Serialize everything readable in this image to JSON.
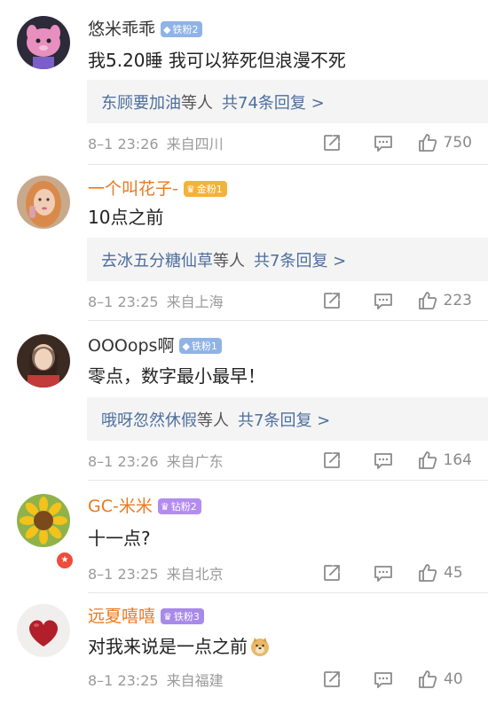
{
  "comments": [
    {
      "username": "悠米乖乖",
      "badge": "铁粉2",
      "content": "我5.20睡 我可以猝死但浪漫不死",
      "reply_name": "东顾要加油",
      "reply_suffix": "等人",
      "reply_count": "共74条回复 >",
      "date": "8–1 23:26",
      "location": "来自四川",
      "likes": "750"
    },
    {
      "username": "一个叫花子-",
      "badge": "金粉1",
      "content": "10点之前",
      "reply_name": "去冰五分糖仙草",
      "reply_suffix": "等人",
      "reply_count": "共7条回复 >",
      "date": "8–1 23:25",
      "location": "来自上海",
      "likes": "223"
    },
    {
      "username": "OOOops啊",
      "badge": "铁粉1",
      "content": "零点，数字最小最早！",
      "reply_name": "哦呀忽然休假",
      "reply_suffix": "等人",
      "reply_count": "共7条回复 >",
      "date": "8–1 23:26",
      "location": "来自广东",
      "likes": "164"
    },
    {
      "username": "GC-米米",
      "badge": "钻粉2",
      "content": "十一点?",
      "date": "8–1 23:25",
      "location": "来自北京",
      "likes": "45"
    },
    {
      "username": "远夏嘻嘻",
      "badge": "铁粉3",
      "content": "对我来说是一点之前",
      "date": "8–1 23:25",
      "location": "来自福建",
      "likes": "40"
    }
  ],
  "icons": {
    "share": "share-icon",
    "comment": "comment-icon",
    "like": "thumbs-up-icon",
    "emoji": "doge-emoji-icon"
  },
  "colors": {
    "link_blue": "#4d6e9e",
    "orange_name": "#e87922",
    "meta_gray": "#9a9a9a"
  }
}
